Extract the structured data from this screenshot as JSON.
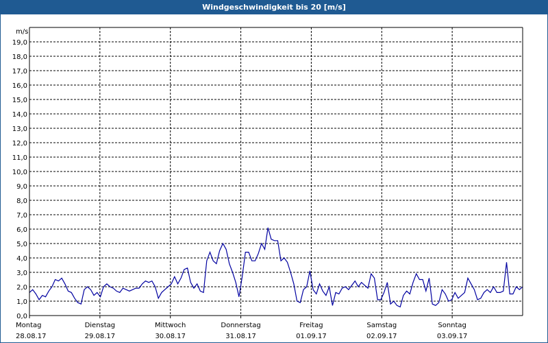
{
  "title": "Windgeschwindigkeit bis 20 [m/s]",
  "colors": {
    "title_bg": "#1f5a92",
    "line": "#0000a0",
    "grid": "#000000"
  },
  "chart_data": {
    "type": "line",
    "title": "Windgeschwindigkeit bis 20 [m/s]",
    "ylabel": "m/s",
    "xlabel": "",
    "ylim": [
      0,
      20
    ],
    "yticks": [
      "0,0",
      "1,0",
      "2,0",
      "3,0",
      "4,0",
      "5,0",
      "6,0",
      "7,0",
      "8,0",
      "9,0",
      "10,0",
      "11,0",
      "12,0",
      "13,0",
      "14,0",
      "15,0",
      "16,0",
      "17,0",
      "18,0",
      "19,0"
    ],
    "xlim_days": [
      0,
      7
    ],
    "x_ticks": [
      {
        "day": "Montag",
        "date": "28.08.17"
      },
      {
        "day": "Dienstag",
        "date": "29.08.17"
      },
      {
        "day": "Mittwoch",
        "date": "30.08.17"
      },
      {
        "day": "Donnerstag",
        "date": "31.08.17"
      },
      {
        "day": "Freitag",
        "date": "01.09.17"
      },
      {
        "day": "Samstag",
        "date": "02.09.17"
      },
      {
        "day": "Sonntag",
        "date": "03.09.17"
      }
    ],
    "grid": true,
    "series": [
      {
        "values": [
          1.6,
          1.8,
          1.5,
          1.1,
          1.4,
          1.3,
          1.7,
          2.0,
          2.5,
          2.4,
          2.6,
          2.2,
          1.7,
          1.6,
          1.2,
          0.9,
          0.8,
          1.8,
          2.0,
          1.8,
          1.4,
          1.6,
          1.3,
          2.0,
          2.2,
          2.0,
          1.9,
          1.7,
          1.6,
          1.9,
          1.8,
          1.7,
          1.8,
          1.9,
          1.9,
          2.2,
          2.4,
          2.3,
          2.4,
          2.0,
          1.2,
          1.6,
          1.8,
          2.0,
          2.2,
          2.7,
          2.2,
          2.6,
          3.2,
          3.3,
          2.3,
          1.9,
          2.2,
          1.7,
          1.6,
          3.8,
          4.4,
          3.8,
          3.6,
          4.5,
          5.0,
          4.6,
          3.6,
          3.0,
          2.3,
          1.3,
          2.7,
          4.4,
          4.4,
          3.8,
          3.8,
          4.3,
          5.0,
          4.6,
          6.1,
          5.3,
          5.2,
          5.2,
          3.8,
          4.0,
          3.7,
          3.0,
          2.2,
          1.0,
          0.9,
          1.8,
          2.0,
          3.1,
          1.8,
          1.5,
          2.2,
          1.7,
          1.4,
          2.0,
          0.7,
          1.6,
          1.5,
          1.9,
          2.0,
          1.8,
          2.1,
          2.4,
          2.0,
          2.3,
          2.1,
          1.9,
          2.9,
          2.6,
          1.1,
          1.1,
          1.6,
          2.3,
          0.8,
          1.0,
          0.7,
          0.6,
          1.4,
          1.7,
          1.5,
          2.3,
          2.9,
          2.5,
          2.5,
          1.7,
          2.6,
          0.8,
          0.7,
          0.9,
          1.8,
          1.5,
          1.0,
          1.1,
          1.6,
          1.2,
          1.4,
          1.6,
          2.6,
          2.2,
          1.8,
          1.1,
          1.2,
          1.6,
          1.8,
          1.6,
          2.0,
          1.6,
          1.6,
          1.7,
          3.7,
          1.5,
          1.5,
          2.0,
          1.8,
          2.0
        ]
      }
    ]
  }
}
